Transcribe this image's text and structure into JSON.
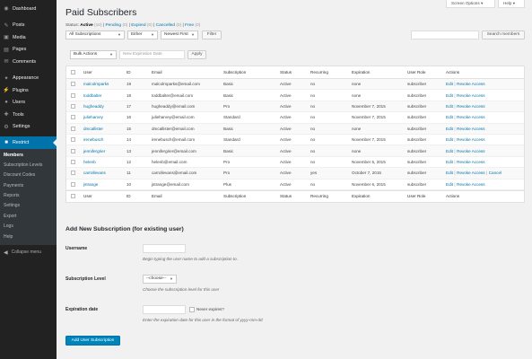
{
  "sidebar": {
    "items": [
      {
        "label": "Dashboard",
        "icon": "dashboard-icon",
        "glyph": "◉"
      },
      {
        "label": "Posts",
        "icon": "pin-icon",
        "glyph": "✎"
      },
      {
        "label": "Media",
        "icon": "media-icon",
        "glyph": "▣"
      },
      {
        "label": "Pages",
        "icon": "page-icon",
        "glyph": "▤"
      },
      {
        "label": "Comments",
        "icon": "comment-icon",
        "glyph": "✉"
      },
      {
        "label": "Appearance",
        "icon": "brush-icon",
        "glyph": "✦"
      },
      {
        "label": "Plugins",
        "icon": "plugin-icon",
        "glyph": "⚡"
      },
      {
        "label": "Users",
        "icon": "user-icon",
        "glyph": "●"
      },
      {
        "label": "Tools",
        "icon": "wrench-icon",
        "glyph": "✚"
      },
      {
        "label": "Settings",
        "icon": "settings-icon",
        "glyph": "⚙"
      },
      {
        "label": "Restrict",
        "icon": "lock-icon",
        "glyph": "■"
      }
    ],
    "submenu": [
      "Members",
      "Subscription Levels",
      "Discount Codes",
      "Payments",
      "Reports",
      "Settings",
      "Export",
      "Logs",
      "Help"
    ],
    "collapse_label": "Collapse menu"
  },
  "screen_options_label": "Screen Options ▾",
  "help_label": "Help ▾",
  "page_title": "Paid Subscribers",
  "status_filter": {
    "label": "Status:",
    "active": "Active",
    "active_count": "(10)",
    "pending": "Pending",
    "pending_count": "(0)",
    "expired": "Expired",
    "expired_count": "(0)",
    "cancelled": "Cancelled",
    "cancelled_count": "(0)",
    "free": "Free",
    "free_count": "(0)"
  },
  "filters": {
    "subscription": "All Subscriptions",
    "recurring": "Either",
    "order": "Newest First",
    "filter_button": "Filter",
    "search_button": "Search members"
  },
  "bulk": {
    "actions": "Bulk Actions",
    "expiration_placeholder": "New Expiration Date",
    "apply": "Apply"
  },
  "table": {
    "headers": {
      "user": "User",
      "id": "ID",
      "email": "Email",
      "subscription": "Subscription",
      "status": "Status",
      "recurring": "Recurring",
      "expiration": "Expiration",
      "role": "User Role",
      "actions": "Actions"
    },
    "action_edit": "Edit",
    "action_revoke": "Revoke Access",
    "action_cancel": "Cancel",
    "rows": [
      {
        "user": "malcolmparks",
        "id": "19",
        "email": "malcolmparks@email.com",
        "subscription": "Basic",
        "status": "Active",
        "recurring": "no",
        "expiration": "none",
        "role": "subscriber"
      },
      {
        "user": "toddbalter",
        "id": "18",
        "email": "toddbalter@email.com",
        "subscription": "Basic",
        "status": "Active",
        "recurring": "no",
        "expiration": "none",
        "role": "subscriber"
      },
      {
        "user": "hugheaddy",
        "id": "17",
        "email": "hugheaddy@email.com",
        "subscription": "Pro",
        "status": "Active",
        "recurring": "no",
        "expiration": "November 7, 2015",
        "role": "subscriber"
      },
      {
        "user": "julieharvey",
        "id": "16",
        "email": "julieharvey@email.com",
        "subscription": "Standard",
        "status": "Active",
        "recurring": "no",
        "expiration": "November 7, 2015",
        "role": "subscriber"
      },
      {
        "user": "dmcallister",
        "id": "15",
        "email": "dmcallister@email.com",
        "subscription": "Basic",
        "status": "Active",
        "recurring": "no",
        "expiration": "none",
        "role": "subscriber"
      },
      {
        "user": "irenebusch",
        "id": "14",
        "email": "irenebusch@email.com",
        "subscription": "Standard",
        "status": "Active",
        "recurring": "no",
        "expiration": "November 7, 2015",
        "role": "subscriber"
      },
      {
        "user": "jennifergrier",
        "id": "13",
        "email": "jennifergrier@email.com",
        "subscription": "Basic",
        "status": "Active",
        "recurring": "no",
        "expiration": "none",
        "role": "subscriber"
      },
      {
        "user": "helenb",
        "id": "12",
        "email": "helenb@email.com",
        "subscription": "Pro",
        "status": "Active",
        "recurring": "no",
        "expiration": "November 5, 2015",
        "role": "subscriber"
      },
      {
        "user": "carrollevans",
        "id": "11",
        "email": "carrollevans@email.com",
        "subscription": "Pro",
        "status": "Active",
        "recurring": "yes",
        "expiration": "October 7, 2015",
        "role": "subscriber",
        "cancel": true
      },
      {
        "user": "jstrange",
        "id": "10",
        "email": "jstrange@email.com",
        "subscription": "Plus",
        "status": "Active",
        "recurring": "no",
        "expiration": "November 6, 2015",
        "role": "subscriber"
      }
    ]
  },
  "add_form": {
    "title": "Add New Subscription (for existing user)",
    "username_label": "Username",
    "username_desc": "Begin typing the user name to add a subscription to.",
    "level_label": "Subscription Level",
    "level_value": "--choose--",
    "level_desc": "Choose the subscription level for this user",
    "expiration_label": "Expiration date",
    "never_expires": "Never expires?",
    "expiration_desc": "Enter the expiration date for this user in the format of yyyy-mm-dd",
    "submit": "Add User Subscription"
  }
}
